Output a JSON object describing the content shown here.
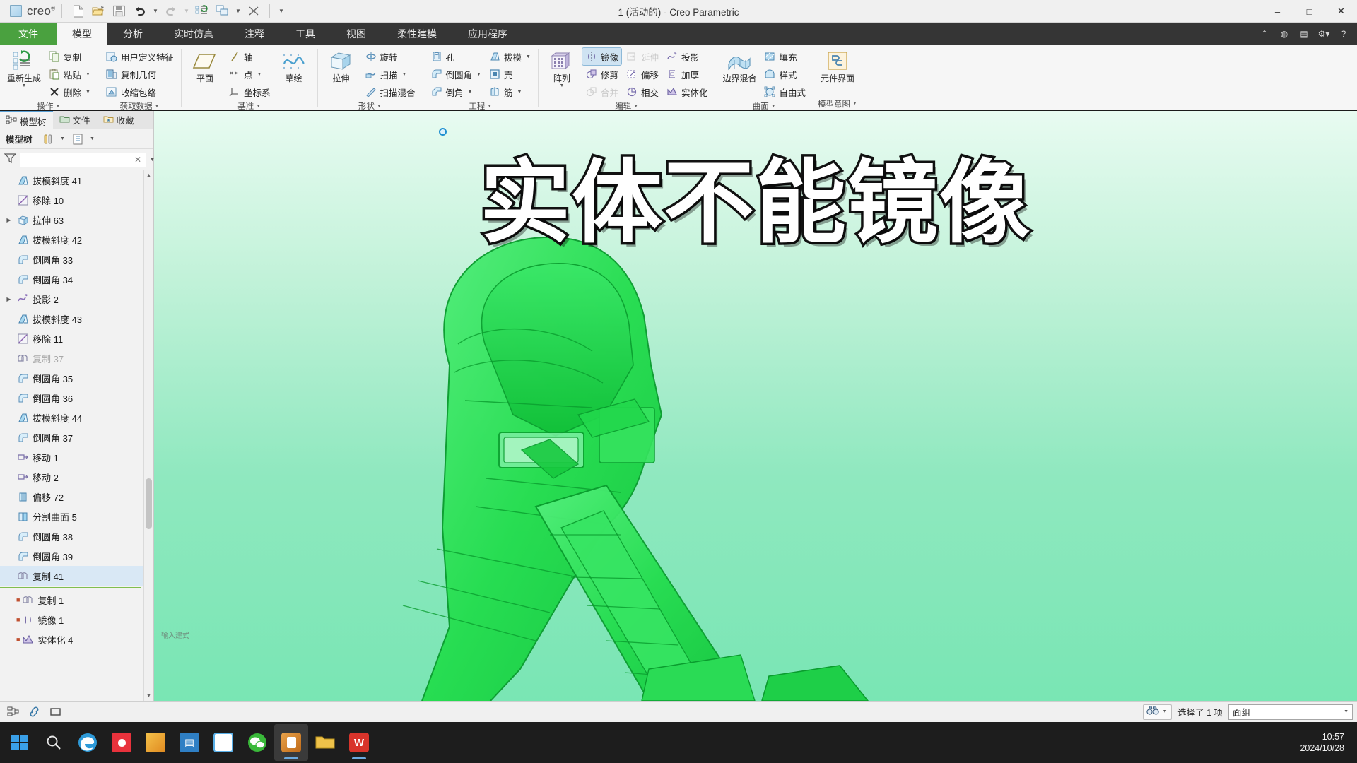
{
  "titlebar": {
    "brand": "creo",
    "brand_sup": "®",
    "window_title": "1 (活动的) - Creo Parametric",
    "quick_access": [
      {
        "name": "new-file-icon",
        "tip": "新建"
      },
      {
        "name": "open-file-icon",
        "tip": "打开"
      },
      {
        "name": "save-icon",
        "tip": "保存"
      },
      {
        "name": "undo-icon",
        "tip": "撤消"
      },
      {
        "name": "redo-icon",
        "tip": "重做"
      },
      {
        "name": "regenerate-icon",
        "tip": "重新生成"
      },
      {
        "name": "window-switch-icon",
        "tip": "窗口"
      },
      {
        "name": "close-window-icon",
        "tip": "关闭"
      }
    ],
    "window_controls": [
      "–",
      "□",
      "✕"
    ]
  },
  "tabs": {
    "items": [
      {
        "label": "文件",
        "kind": "file"
      },
      {
        "label": "模型",
        "kind": "active"
      },
      {
        "label": "分析",
        "kind": "normal"
      },
      {
        "label": "实时仿真",
        "kind": "normal"
      },
      {
        "label": "注释",
        "kind": "normal"
      },
      {
        "label": "工具",
        "kind": "normal"
      },
      {
        "label": "视图",
        "kind": "normal"
      },
      {
        "label": "柔性建模",
        "kind": "normal"
      },
      {
        "label": "应用程序",
        "kind": "normal"
      }
    ],
    "right_icons": [
      "chevron-up-icon",
      "globe-icon",
      "display-icon",
      "settings-caret-icon",
      "help-icon"
    ]
  },
  "ribbon": {
    "groups": [
      {
        "label": "操作",
        "has_caret": true,
        "big": [
          {
            "label": "重新生成",
            "icon": "regenerate-icon",
            "caret": true
          }
        ],
        "small": [
          {
            "label": "复制",
            "icon": "copy-icon",
            "caret": false,
            "disabled": false
          },
          {
            "label": "粘贴",
            "icon": "paste-icon",
            "caret": true,
            "disabled": false
          },
          {
            "label": "删除",
            "icon": "delete-x-icon",
            "caret": true,
            "disabled": false
          }
        ]
      },
      {
        "label": "获取数据",
        "has_caret": true,
        "big": [],
        "small": [
          {
            "label": "用户定义特征",
            "icon": "udf-icon",
            "caret": false,
            "disabled": false
          },
          {
            "label": "复制几何",
            "icon": "copy-geom-icon",
            "caret": false,
            "disabled": false
          },
          {
            "label": "收缩包络",
            "icon": "shrinkwrap-icon",
            "caret": false,
            "disabled": false
          }
        ]
      },
      {
        "label": "基准",
        "has_caret": true,
        "big": [
          {
            "label": "平面",
            "icon": "datum-plane-icon",
            "caret": false
          }
        ],
        "small": [
          {
            "label": "轴",
            "icon": "datum-axis-icon",
            "caret": false,
            "disabled": false
          },
          {
            "label": "点",
            "icon": "datum-point-icon",
            "caret": true,
            "disabled": false
          },
          {
            "label": "坐标系",
            "icon": "datum-csys-icon",
            "caret": false,
            "disabled": false
          }
        ],
        "big2": [
          {
            "label": "草绘",
            "icon": "sketch-icon",
            "caret": false
          }
        ]
      },
      {
        "label": "形状",
        "has_caret": true,
        "big": [
          {
            "label": "拉伸",
            "icon": "extrude-icon",
            "caret": false
          }
        ],
        "small": [
          {
            "label": "旋转",
            "icon": "revolve-icon",
            "caret": false,
            "disabled": false
          },
          {
            "label": "扫描",
            "icon": "sweep-icon",
            "caret": true,
            "disabled": false
          },
          {
            "label": "扫描混合",
            "icon": "swept-blend-icon",
            "caret": false,
            "disabled": false
          }
        ]
      },
      {
        "label": "工程",
        "has_caret": true,
        "big": [],
        "small": [
          {
            "label": "孔",
            "icon": "hole-icon",
            "caret": false,
            "disabled": false
          },
          {
            "label": "倒圆角",
            "icon": "round-icon",
            "caret": true,
            "disabled": false
          },
          {
            "label": "倒角",
            "icon": "chamfer-icon",
            "caret": true,
            "disabled": false
          }
        ],
        "small2": [
          {
            "label": "拔模",
            "icon": "draft-icon",
            "caret": true,
            "disabled": false
          },
          {
            "label": "壳",
            "icon": "shell-icon",
            "caret": false,
            "disabled": false
          },
          {
            "label": "筋",
            "icon": "rib-icon",
            "caret": true,
            "disabled": false
          }
        ]
      },
      {
        "label": "编辑",
        "has_caret": true,
        "big": [
          {
            "label": "阵列",
            "icon": "pattern-icon",
            "caret": true
          }
        ],
        "small": [
          {
            "label": "镜像",
            "icon": "mirror-icon",
            "caret": false,
            "disabled": false,
            "selected": true
          },
          {
            "label": "修剪",
            "icon": "trim-icon",
            "caret": false,
            "disabled": false
          },
          {
            "label": "合并",
            "icon": "merge-icon",
            "caret": false,
            "disabled": true
          }
        ],
        "small2": [
          {
            "label": "延伸",
            "icon": "extend-icon",
            "caret": false,
            "disabled": true
          },
          {
            "label": "偏移",
            "icon": "offset-icon",
            "caret": false,
            "disabled": false
          },
          {
            "label": "相交",
            "icon": "intersect-icon",
            "caret": false,
            "disabled": false
          }
        ],
        "small3": [
          {
            "label": "投影",
            "icon": "project-icon",
            "caret": false,
            "disabled": false
          },
          {
            "label": "加厚",
            "icon": "thicken-icon",
            "caret": false,
            "disabled": false
          },
          {
            "label": "实体化",
            "icon": "solidify-icon",
            "caret": false,
            "disabled": false
          }
        ]
      },
      {
        "label": "曲面",
        "has_caret": true,
        "big": [
          {
            "label": "边界混合",
            "icon": "boundary-blend-icon",
            "caret": false
          }
        ],
        "small": [
          {
            "label": "填充",
            "icon": "fill-icon",
            "caret": false,
            "disabled": false
          },
          {
            "label": "样式",
            "icon": "style-icon",
            "caret": false,
            "disabled": false
          },
          {
            "label": "自由式",
            "icon": "freestyle-icon",
            "caret": false,
            "disabled": false
          }
        ]
      },
      {
        "label": "模型意图",
        "has_caret": true,
        "big": [
          {
            "label": "元件界面",
            "icon": "component-interface-icon",
            "caret": false
          }
        ],
        "small": []
      }
    ]
  },
  "left_panel": {
    "tabs": [
      {
        "label": "模型树",
        "icon": "model-tree-icon",
        "active": true
      },
      {
        "label": "文件",
        "icon": "folder-icon",
        "active": false
      },
      {
        "label": "收藏",
        "icon": "favorites-icon",
        "active": false
      }
    ],
    "toolbar_title": "模型树",
    "filter_value": "",
    "filter_placeholder": "",
    "tree_items": [
      {
        "label": "拔模斜度 41",
        "icon": "draft-feature-icon",
        "expandable": false,
        "state": "normal"
      },
      {
        "label": "移除 10",
        "icon": "remove-feature-icon",
        "expandable": false,
        "state": "normal"
      },
      {
        "label": "拉伸 63",
        "icon": "extrude-feature-icon",
        "expandable": true,
        "state": "normal"
      },
      {
        "label": "拔模斜度 42",
        "icon": "draft-feature-icon",
        "expandable": false,
        "state": "normal"
      },
      {
        "label": "倒圆角 33",
        "icon": "round-feature-icon",
        "expandable": false,
        "state": "normal"
      },
      {
        "label": "倒圆角 34",
        "icon": "round-feature-icon",
        "expandable": false,
        "state": "normal"
      },
      {
        "label": "投影 2",
        "icon": "project-feature-icon",
        "expandable": true,
        "state": "normal"
      },
      {
        "label": "拔模斜度 43",
        "icon": "draft-feature-icon",
        "expandable": false,
        "state": "normal"
      },
      {
        "label": "移除 11",
        "icon": "remove-feature-icon",
        "expandable": false,
        "state": "normal"
      },
      {
        "label": "复制 37",
        "icon": "copy-feature-icon",
        "expandable": false,
        "state": "dimmed"
      },
      {
        "label": "倒圆角 35",
        "icon": "round-feature-icon",
        "expandable": false,
        "state": "normal"
      },
      {
        "label": "倒圆角 36",
        "icon": "round-feature-icon",
        "expandable": false,
        "state": "normal"
      },
      {
        "label": "拔模斜度 44",
        "icon": "draft-feature-icon",
        "expandable": false,
        "state": "normal"
      },
      {
        "label": "倒圆角 37",
        "icon": "round-feature-icon",
        "expandable": false,
        "state": "normal"
      },
      {
        "label": "移动 1",
        "icon": "move-feature-icon",
        "expandable": false,
        "state": "normal"
      },
      {
        "label": "移动 2",
        "icon": "move-feature-icon",
        "expandable": false,
        "state": "normal"
      },
      {
        "label": "偏移 72",
        "icon": "offset-feature-icon",
        "expandable": false,
        "state": "normal"
      },
      {
        "label": "分割曲面 5",
        "icon": "split-surface-icon",
        "expandable": false,
        "state": "normal"
      },
      {
        "label": "倒圆角 38",
        "icon": "round-feature-icon",
        "expandable": false,
        "state": "normal"
      },
      {
        "label": "倒圆角 39",
        "icon": "round-feature-icon",
        "expandable": false,
        "state": "normal"
      },
      {
        "label": "复制 41",
        "icon": "copy-feature-icon",
        "expandable": false,
        "state": "selected"
      }
    ],
    "tree_items_below": [
      {
        "label": "复制 1",
        "icon": "copy-feature-icon",
        "marker": true
      },
      {
        "label": "镜像 1",
        "icon": "mirror-feature-icon",
        "marker": true
      },
      {
        "label": "实体化 4",
        "icon": "solidify-feature-icon",
        "marker": true
      }
    ]
  },
  "graphics": {
    "overlay_text": "实体不能镜像",
    "hint_text": "输入建式",
    "bg_top": "#e8fbf1",
    "bg_bottom": "#79e6b4",
    "model_color": "#2ee05a"
  },
  "statusbar": {
    "left_icons": [
      "layers-icon",
      "link-icon",
      "rect-select-icon"
    ],
    "find_icon": "binoculars-icon",
    "selection_text": "选择了 1 项",
    "filter_value": "面组"
  },
  "taskbar": {
    "start_icon": "windows-start-icon",
    "search_icon": "search-icon",
    "items": [
      {
        "name": "taskbar-edge",
        "color": "#3fb5e8",
        "running": false
      },
      {
        "name": "taskbar-recorder",
        "color": "#e8323c",
        "running": false
      },
      {
        "name": "taskbar-app-orange",
        "color": "#f0a030",
        "running": false
      },
      {
        "name": "taskbar-explorer-blue",
        "color": "#4a9fd8",
        "running": false
      },
      {
        "name": "taskbar-notepad",
        "color": "#5ab0e8",
        "running": false
      },
      {
        "name": "taskbar-wechat",
        "color": "#46b03a",
        "running": false
      },
      {
        "name": "taskbar-creo",
        "color": "#d98a2b",
        "running": true,
        "active": true
      },
      {
        "name": "taskbar-folder",
        "color": "#e8c03a",
        "running": false
      },
      {
        "name": "taskbar-wps",
        "color": "#d8342b",
        "running": true
      }
    ],
    "clock_time": "10:57",
    "clock_date": "2024/10/28"
  }
}
